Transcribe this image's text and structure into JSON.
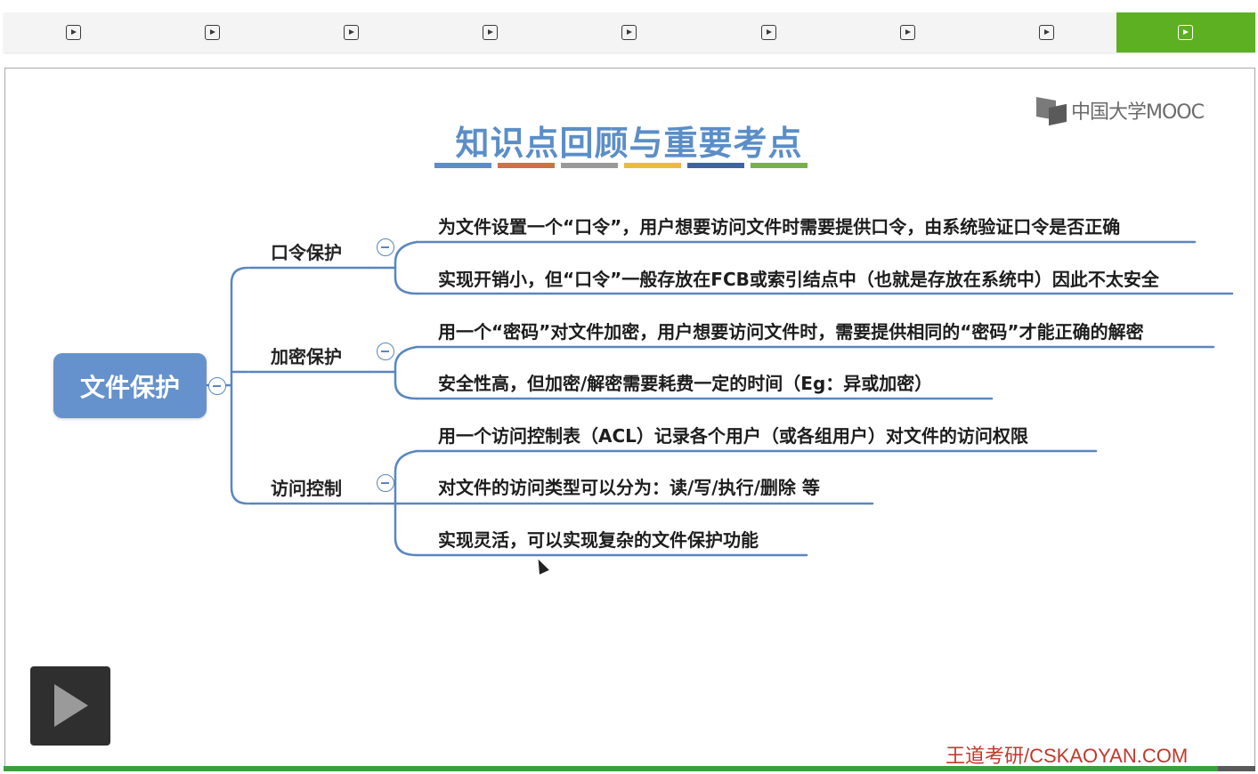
{
  "chapters": {
    "items": [
      "",
      "",
      "",
      "",
      "",
      "",
      "",
      "",
      ""
    ],
    "active_index": 8,
    "icon": "play-square-icon"
  },
  "slide": {
    "logo_text": "中国大学MOOC",
    "title": "知识点回顾与重要考点",
    "title_bar_colors": [
      "#5b8ec8",
      "#d0713f",
      "#9a9a9a",
      "#f0b93c",
      "#3e62a6",
      "#78b04a"
    ]
  },
  "mindmap": {
    "root": "文件保护",
    "branches": [
      {
        "label": "口令保护",
        "leaves": [
          "为文件设置一个“口令”，用户想要访问文件时需要提供口令，由系统验证口令是否正确",
          "实现开销小，但“口令”一般存放在FCB或索引结点中（也就是存放在系统中）因此不太安全"
        ]
      },
      {
        "label": "加密保护",
        "leaves": [
          "用一个“密码”对文件加密，用户想要访问文件时，需要提供相同的“密码”才能正确的解密",
          "安全性高，但加密/解密需要耗费一定的时间（Eg：异或加密）"
        ]
      },
      {
        "label": "访问控制",
        "leaves": [
          "用一个访问控制表（ACL）记录各个用户（或各组用户）对文件的访问权限",
          "对文件的访问类型可以分为：读/写/执行/删除 等",
          "实现灵活，可以实现复杂的文件保护功能"
        ]
      }
    ],
    "line_color": "#5a86c0"
  },
  "footer": {
    "watermark": "王道考研/CSKAOYAN.COM"
  },
  "player": {
    "play_icon": "play-icon",
    "progress": 0.97,
    "progress_color": "#3aa03a"
  }
}
